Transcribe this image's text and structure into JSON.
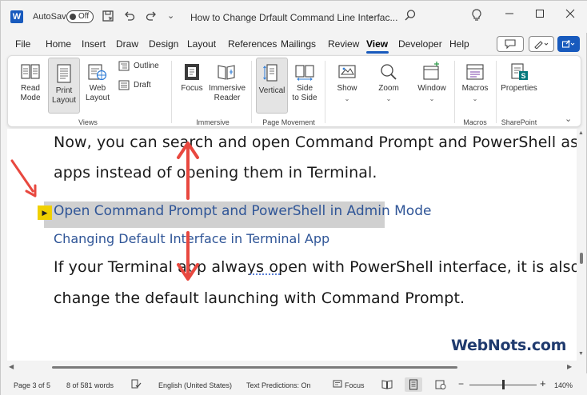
{
  "titlebar": {
    "autosave_label": "AutoSave",
    "autosave_state": "Off",
    "title": "How to Change Drfault Command Line Interfac...",
    "title_caret": "⌄",
    "icons": [
      "save-icon",
      "undo-icon",
      "redo-icon",
      "customize-quick-access-icon",
      "search-icon",
      "lightbulb-icon",
      "minimize-icon",
      "maximize-icon",
      "close-icon"
    ]
  },
  "menu": {
    "tabs": [
      "File",
      "Home",
      "Insert",
      "Draw",
      "Design",
      "Layout",
      "References",
      "Mailings",
      "Review",
      "View",
      "Developer",
      "Help"
    ],
    "active_tab": "View"
  },
  "ribbon": {
    "views": {
      "read_mode": "Read\nMode",
      "print_layout": "Print\nLayout",
      "web_layout": "Web\nLayout",
      "outline": "Outline",
      "draft": "Draft",
      "label": "Views"
    },
    "immersive": {
      "focus": "Focus",
      "immersive_reader": "Immersive\nReader",
      "label": "Immersive"
    },
    "page_movement": {
      "vertical": "Vertical",
      "side_to_side": "Side\nto Side",
      "label": "Page Movement"
    },
    "show": "Show",
    "zoom": "Zoom",
    "window": "Window",
    "macros": {
      "button": "Macros",
      "label": "Macros"
    },
    "sharepoint": {
      "properties": "Properties",
      "label": "SharePoint"
    }
  },
  "document": {
    "line1": "Now, you can search and open Command Prompt and PowerShell as indepe",
    "line2": "apps instead of opening them in Terminal.",
    "heading1": "Open Command Prompt and PowerShell in Admin Mode",
    "heading2": "Changing Default Interface in Terminal App",
    "line3": "If your Terminal app always open with PowerShell interface, it is also possib",
    "line4": "change the default launching with Command Prompt."
  },
  "watermark": "WebNots.com",
  "statusbar": {
    "page": "Page 3 of 5",
    "words": "8 of 581 words",
    "language": "English (United States)",
    "text_predictions": "Text Predictions: On",
    "focus": "Focus",
    "zoom_level": "140%",
    "zoom_minus": "−",
    "zoom_plus": "+"
  },
  "colors": {
    "accent": "#185abd",
    "heading": "#2f5597",
    "highlight": "#d0d0d0",
    "arrow": "#e8483f",
    "collapse_marker": "#f0d000"
  }
}
